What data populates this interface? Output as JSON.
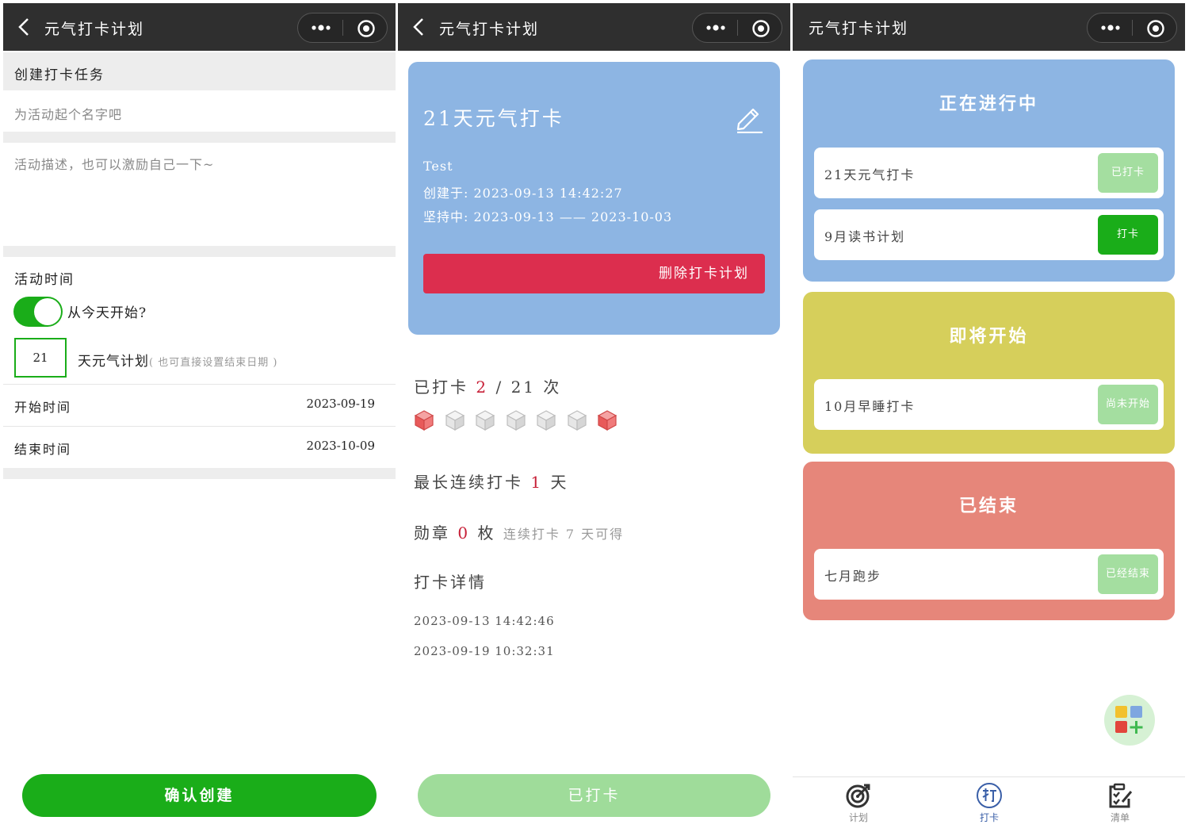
{
  "app_title": "元气打卡计划",
  "create": {
    "header": "创建打卡任务",
    "name_placeholder": "为活动起个名字吧",
    "desc_placeholder": "活动描述，也可以激励自己一下~",
    "time_header": "活动时间",
    "toggle_label": "从今天开始?",
    "toggle_on": true,
    "days_value": "21",
    "days_label": "天元气计划",
    "days_hint": "( 也可直接设置结束日期 )",
    "start_label": "开始时间",
    "start_value": "2023-09-19",
    "end_label": "结束时间",
    "end_value": "2023-10-09",
    "confirm_button": "确认创建"
  },
  "detail": {
    "title": "21天元气打卡",
    "desc": "Test",
    "created": "创建于: 2023-09-13  14:42:27",
    "period": "坚持中: 2023-09-13 —— 2023-10-03",
    "delete_button": "删除打卡计划",
    "checked_prefix": "已打卡",
    "checked_count": "2",
    "checked_sep": "/",
    "checked_total": "21",
    "checked_suffix": "次",
    "cubes": [
      true,
      false,
      false,
      false,
      false,
      false,
      true
    ],
    "streak_prefix": "最长连续打卡",
    "streak_value": "1",
    "streak_suffix": "天",
    "medal_prefix": "勋章",
    "medal_value": "0",
    "medal_suffix": "枚",
    "medal_hint": "连续打卡 7 天可得",
    "records_title": "打卡详情",
    "records": [
      "2023-09-13  14:42:46",
      "2023-09-19  10:32:31"
    ],
    "done_button": "已打卡"
  },
  "list": {
    "groups": [
      {
        "title": "正在进行中",
        "color": "#8db5e3",
        "items": [
          {
            "name": "21天元气打卡",
            "button": "已打卡",
            "button_color": "#a4dea0"
          },
          {
            "name": "9月读书计划",
            "button": "打卡",
            "button_color": "#1aad19"
          }
        ]
      },
      {
        "title": "即将开始",
        "color": "#d6cf5b",
        "items": [
          {
            "name": "10月早睡打卡",
            "button": "尚未开始",
            "button_color": "#a4dea0"
          }
        ]
      },
      {
        "title": "已结束",
        "color": "#e6867a",
        "items": [
          {
            "name": "七月跑步",
            "button": "已经结束",
            "button_color": "#a4dea0"
          }
        ]
      }
    ],
    "tabs": [
      {
        "label": "计划",
        "icon": "target-icon",
        "active": false
      },
      {
        "label": "打卡",
        "icon": "checkin-stamp-icon",
        "active": true
      },
      {
        "label": "清单",
        "icon": "checklist-icon",
        "active": false
      }
    ]
  },
  "colors": {
    "green": "#1aad19",
    "navbar": "#2f2f2f",
    "red": "#dc2e4e",
    "accent_num": "#c71f37"
  }
}
